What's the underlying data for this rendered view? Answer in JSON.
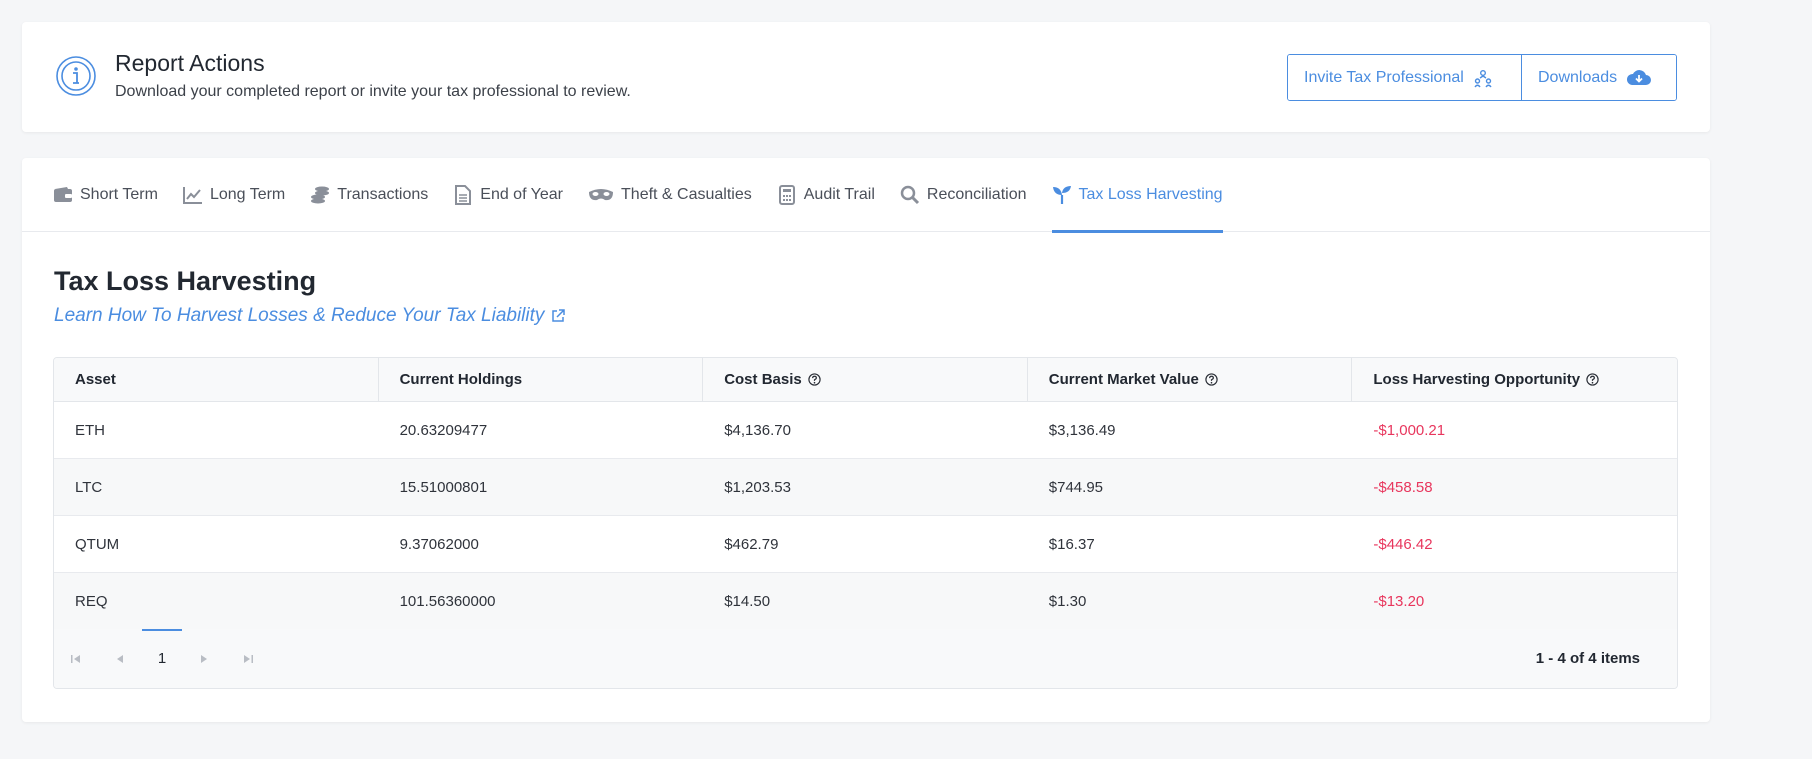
{
  "report": {
    "title": "Report Actions",
    "description": "Download your completed report or invite your tax professional to review.",
    "invite_label": "Invite Tax Professional",
    "downloads_label": "Downloads"
  },
  "tabs": [
    {
      "label": "Short Term",
      "icon": "wallet-icon"
    },
    {
      "label": "Long Term",
      "icon": "line-chart-icon"
    },
    {
      "label": "Transactions",
      "icon": "coins-icon"
    },
    {
      "label": "End of Year",
      "icon": "document-icon"
    },
    {
      "label": "Theft & Casualties",
      "icon": "mask-icon"
    },
    {
      "label": "Audit Trail",
      "icon": "calculator-icon"
    },
    {
      "label": "Reconciliation",
      "icon": "search-icon"
    },
    {
      "label": "Tax Loss Harvesting",
      "icon": "seedling-icon",
      "active": true
    }
  ],
  "section": {
    "title": "Tax Loss Harvesting",
    "link": "Learn How To Harvest Losses & Reduce Your Tax Liability"
  },
  "table": {
    "headers": [
      "Asset",
      "Current Holdings",
      "Cost Basis",
      "Current Market Value",
      "Loss Harvesting Opportunity"
    ],
    "rows": [
      {
        "asset": "ETH",
        "holdings": "20.63209477",
        "cost_basis": "$4,136.70",
        "market_value": "$3,136.49",
        "opportunity": "-$1,000.21"
      },
      {
        "asset": "LTC",
        "holdings": "15.51000801",
        "cost_basis": "$1,203.53",
        "market_value": "$744.95",
        "opportunity": "-$458.58"
      },
      {
        "asset": "QTUM",
        "holdings": "9.37062000",
        "cost_basis": "$462.79",
        "market_value": "$16.37",
        "opportunity": "-$446.42"
      },
      {
        "asset": "REQ",
        "holdings": "101.56360000",
        "cost_basis": "$14.50",
        "market_value": "$1.30",
        "opportunity": "-$13.20"
      }
    ]
  },
  "pager": {
    "current_page": "1",
    "info": "1 - 4 of 4 items"
  },
  "colors": {
    "accent": "#4b8de0",
    "negative": "#e8365d"
  }
}
